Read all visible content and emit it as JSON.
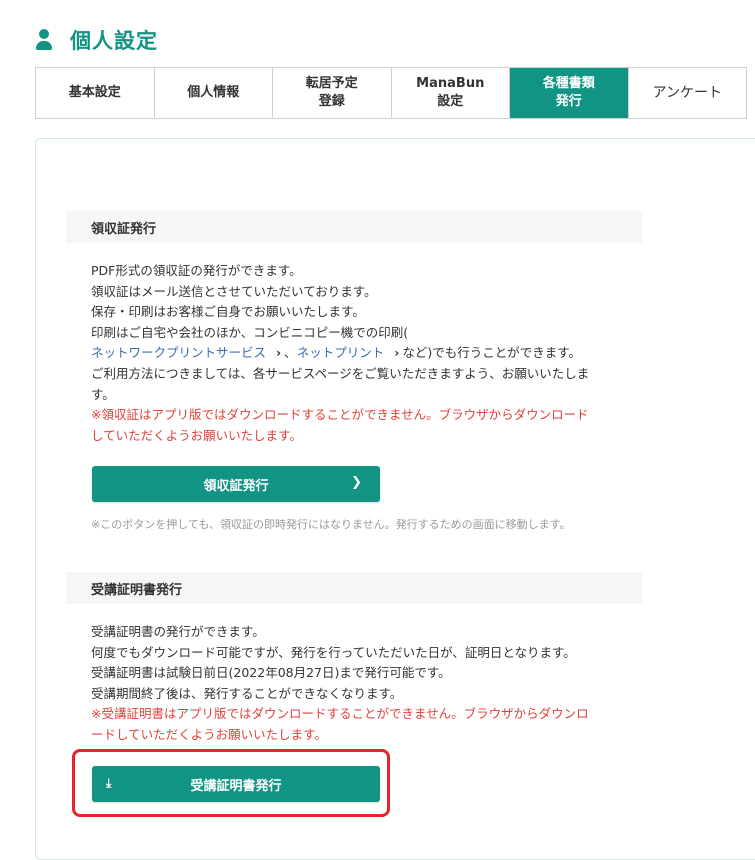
{
  "header": {
    "title": "個人設定",
    "icon": "person-icon"
  },
  "tabs": [
    {
      "label": "基本設定"
    },
    {
      "label": "個人情報"
    },
    {
      "label": "転居予定\n登録"
    },
    {
      "label": "ManaBun\n設定"
    },
    {
      "label": "各種書類\n発行",
      "active": true
    },
    {
      "label": "アンケート"
    }
  ],
  "receipt": {
    "heading": "領収証発行",
    "line1": "PDF形式の領収証の発行ができます。",
    "line2": "領収証はメール送信とさせていただいております。",
    "line3": "保存・印刷はお客様ご自身でお願いいたします。",
    "line4": "印刷はご自宅や会社のほか、コンビニコピー機での印刷(",
    "link1": "ネットワークプリントサービス",
    "sep": "、",
    "link2": "ネットプリント",
    "line5_tail": "など)でも行うことができます。",
    "line6": "ご利用方法につきましては、各サービスページをご覧いただきますよう、お願いいたしま",
    "line7": "す。",
    "warn1": "※領収証はアプリ版ではダウンロードすることができません。ブラウザからダウンロード",
    "warn2": "していただくようお願いいたします。",
    "button": "領収証発行",
    "note": "※このボタンを押しても、領収証の即時発行にはなりません。発行するための画面に移動します。"
  },
  "certificate": {
    "heading": "受講証明書発行",
    "line1": "受講証明書の発行ができます。",
    "line2": "何度でもダウンロード可能ですが、発行を行っていただいた日が、証明日となります。",
    "line3": "受講証明書は試験日前日(2022年08月27日)まで発行可能です。",
    "line4": "受講期間終了後は、発行することができなくなります。",
    "warn1": "※受講証明書はアプリ版ではダウンロードすることができません。ブラウザからダウンロ",
    "warn2": "ードしていただくようお願いいたします。",
    "button": "受講証明書発行"
  },
  "colors": {
    "accent": "#119483",
    "warning": "#e0413a",
    "highlight": "#e5252a"
  }
}
